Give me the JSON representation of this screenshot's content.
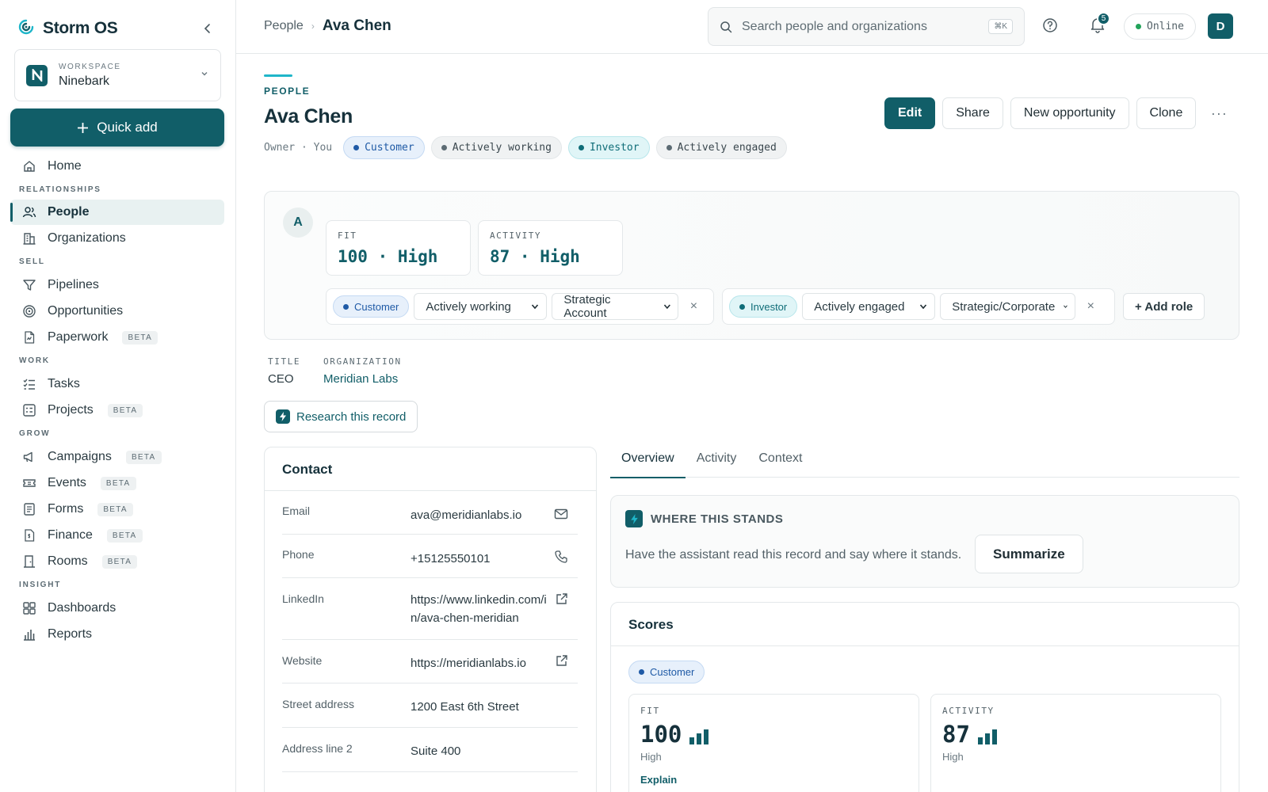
{
  "brand": {
    "name": "Storm OS"
  },
  "workspace": {
    "label": "WORKSPACE",
    "name": "Ninebark",
    "logo_letter": "N"
  },
  "quick_add": {
    "label": "Quick add"
  },
  "sidebar": {
    "home": {
      "label": "Home"
    },
    "sections": {
      "relationships": "RELATIONSHIPS",
      "sell": "SELL",
      "work": "WORK",
      "grow": "GROW",
      "insight": "INSIGHT"
    },
    "items": {
      "people": "People",
      "organizations": "Organizations",
      "pipelines": "Pipelines",
      "opportunities": "Opportunities",
      "paperwork": "Paperwork",
      "tasks": "Tasks",
      "projects": "Projects",
      "campaigns": "Campaigns",
      "events": "Events",
      "forms": "Forms",
      "finance": "Finance",
      "rooms": "Rooms",
      "dashboards": "Dashboards",
      "reports": "Reports"
    },
    "beta_label": "BETA"
  },
  "topbar": {
    "breadcrumb_root": "People",
    "breadcrumb_sep": "›",
    "breadcrumb_current": "Ava Chen",
    "search_placeholder": "Search people and organizations",
    "search_shortcut": "⌘K",
    "notification_count": "5",
    "status": "Online",
    "status_color": "#22a35a",
    "avatar_initial": "D"
  },
  "header": {
    "eyebrow": "PEOPLE",
    "title": "Ava Chen",
    "owner": "Owner · You",
    "tags": [
      "Customer",
      "Actively working",
      "Investor",
      "Actively engaged"
    ],
    "actions": {
      "edit": "Edit",
      "share": "Share",
      "new_opportunity": "New opportunity",
      "clone": "Clone",
      "more": "···"
    }
  },
  "score_card": {
    "initial": "A",
    "fit": {
      "label": "FIT",
      "value": "100 · High"
    },
    "activity": {
      "label": "ACTIVITY",
      "value": "87 · High"
    },
    "roles": [
      {
        "role": "Customer",
        "status": "Actively working",
        "segment": "Strategic Account"
      },
      {
        "role": "Investor",
        "status": "Actively engaged",
        "segment": "Strategic/Corporate"
      }
    ],
    "add_role": "+ Add role",
    "remove": "×"
  },
  "fields": {
    "title_label": "TITLE",
    "title_value": "CEO",
    "org_label": "ORGANIZATION",
    "org_value": "Meridian Labs"
  },
  "research_button": "Research this record",
  "contact": {
    "heading": "Contact",
    "rows": [
      {
        "key": "Email",
        "value": "ava@meridianlabs.io",
        "icon": "mail-icon"
      },
      {
        "key": "Phone",
        "value": "+15125550101",
        "icon": "phone-icon"
      },
      {
        "key": "LinkedIn",
        "value": "https://www.linkedin.com/in/ava-chen-meridian",
        "icon": "external-link-icon"
      },
      {
        "key": "Website",
        "value": "https://meridianlabs.io",
        "icon": "external-link-icon"
      },
      {
        "key": "Street address",
        "value": "1200 East 6th Street"
      },
      {
        "key": "Address line 2",
        "value": "Suite 400"
      }
    ]
  },
  "tabs": [
    "Overview",
    "Activity",
    "Context"
  ],
  "stands": {
    "title": "WHERE THIS STANDS",
    "text": "Have the assistant read this record and say where it stands.",
    "button": "Summarize"
  },
  "scores": {
    "heading": "Scores",
    "role": "Customer",
    "fit": {
      "label": "FIT",
      "value": "100",
      "level": "High",
      "explain": "Explain"
    },
    "activity": {
      "label": "ACTIVITY",
      "value": "87",
      "level": "High"
    }
  },
  "colors": {
    "brand": "#115e68",
    "accent": "#1fb6c9",
    "customer": "#1f5aa6",
    "investor": "#0f6d78"
  }
}
